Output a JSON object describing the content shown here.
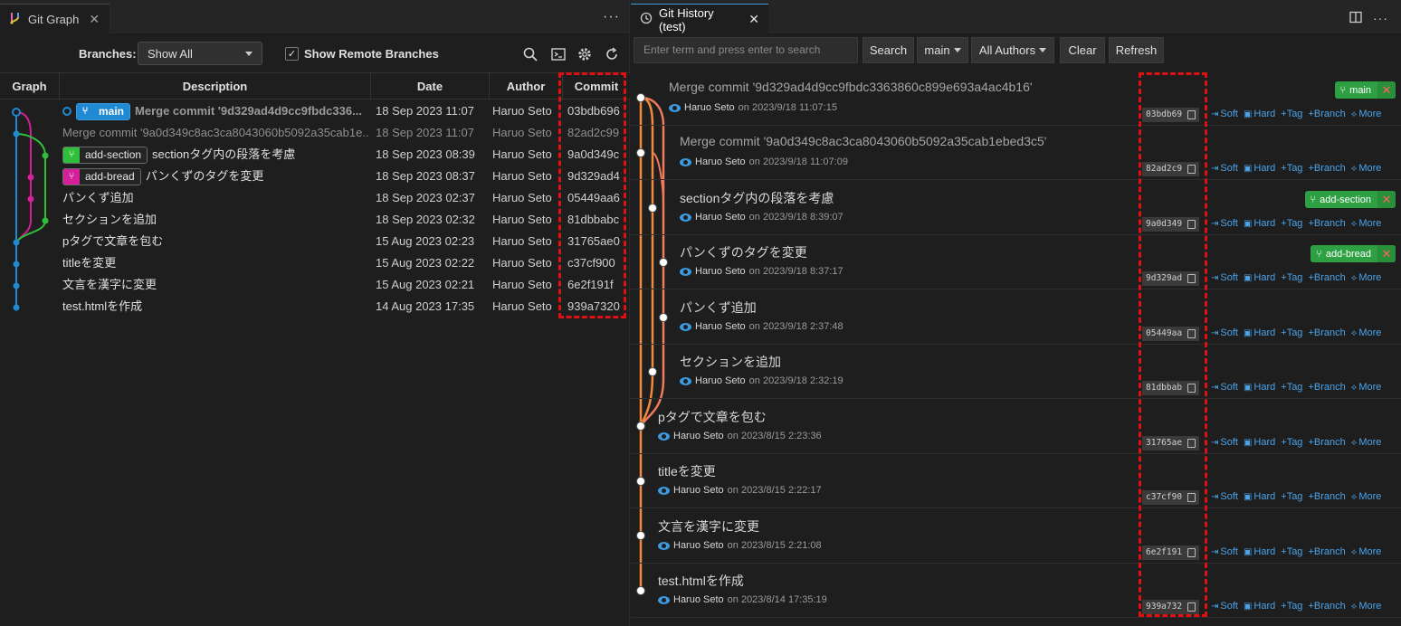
{
  "left_panel": {
    "tab_title": "Git Graph",
    "controls": {
      "branches_label": "Branches:",
      "branches_value": "Show All",
      "show_remote_label": "Show Remote Branches",
      "show_remote_checked": true
    },
    "columns": [
      "Graph",
      "Description",
      "Date",
      "Author",
      "Commit"
    ],
    "rows": [
      {
        "ref": "main",
        "desc": "Merge commit '9d329ad4d9cc9fbdc336...",
        "date": "18 Sep 2023 11:07",
        "author": "Haruo Seto",
        "commit": "03bdb696"
      },
      {
        "ref": "",
        "desc": "Merge commit '9a0d349c8ac3ca8043060b5092a35cab1e...",
        "date": "18 Sep 2023 11:07",
        "author": "Haruo Seto",
        "commit": "82ad2c99"
      },
      {
        "ref": "add-section",
        "desc": "sectionタグ内の段落を考慮",
        "date": "18 Sep 2023 08:39",
        "author": "Haruo Seto",
        "commit": "9a0d349c"
      },
      {
        "ref": "add-bread",
        "desc": "パンくずのタグを変更",
        "date": "18 Sep 2023 08:37",
        "author": "Haruo Seto",
        "commit": "9d329ad4"
      },
      {
        "ref": "",
        "desc": "パンくず追加",
        "date": "18 Sep 2023 02:37",
        "author": "Haruo Seto",
        "commit": "05449aa6"
      },
      {
        "ref": "",
        "desc": "セクションを追加",
        "date": "18 Sep 2023 02:32",
        "author": "Haruo Seto",
        "commit": "81dbbabc"
      },
      {
        "ref": "",
        "desc": "pタグで文章を包む",
        "date": "15 Aug 2023 02:23",
        "author": "Haruo Seto",
        "commit": "31765ae0"
      },
      {
        "ref": "",
        "desc": "titleを変更",
        "date": "15 Aug 2023 02:22",
        "author": "Haruo Seto",
        "commit": "c37cf900"
      },
      {
        "ref": "",
        "desc": "文言を漢字に変更",
        "date": "15 Aug 2023 02:21",
        "author": "Haruo Seto",
        "commit": "6e2f191f"
      },
      {
        "ref": "",
        "desc": "test.htmlを作成",
        "date": "14 Aug 2023 17:35",
        "author": "Haruo Seto",
        "commit": "939a7320"
      }
    ]
  },
  "right_panel": {
    "tab_title": "Git History (test)",
    "search_placeholder": "Enter term and press enter to search",
    "buttons": {
      "search": "Search",
      "branch": "main",
      "authors": "All Authors",
      "clear": "Clear",
      "refresh": "Refresh"
    },
    "actions": {
      "soft": "Soft",
      "hard": "Hard",
      "tag": "+Tag",
      "branch": "+Branch",
      "more": "More"
    },
    "commits": [
      {
        "msg": "Merge commit '9d329ad4d9cc9fbdc3363860c899e693a4ac4b16'",
        "author": "Haruo Seto",
        "when": "on 2023/9/18 11:07:15",
        "hash": "03bdb69",
        "branch": "main"
      },
      {
        "msg": "Merge commit '9a0d349c8ac3ca8043060b5092a35cab1ebed3c5'",
        "author": "Haruo Seto",
        "when": "on 2023/9/18 11:07:09",
        "hash": "82ad2c9",
        "branch": ""
      },
      {
        "msg": "sectionタグ内の段落を考慮",
        "author": "Haruo Seto",
        "when": "on 2023/9/18 8:39:07",
        "hash": "9a0d349",
        "branch": "add-section"
      },
      {
        "msg": "パンくずのタグを変更",
        "author": "Haruo Seto",
        "when": "on 2023/9/18 8:37:17",
        "hash": "9d329ad",
        "branch": "add-bread"
      },
      {
        "msg": "パンくず追加",
        "author": "Haruo Seto",
        "when": "on 2023/9/18 2:37:48",
        "hash": "05449aa",
        "branch": ""
      },
      {
        "msg": "セクションを追加",
        "author": "Haruo Seto",
        "when": "on 2023/9/18 2:32:19",
        "hash": "81dbbab",
        "branch": ""
      },
      {
        "msg": "pタグで文章を包む",
        "author": "Haruo Seto",
        "when": "on 2023/8/15 2:23:36",
        "hash": "31765ae",
        "branch": ""
      },
      {
        "msg": "titleを変更",
        "author": "Haruo Seto",
        "when": "on 2023/8/15 2:22:17",
        "hash": "c37cf90",
        "branch": ""
      },
      {
        "msg": "文言を漢字に変更",
        "author": "Haruo Seto",
        "when": "on 2023/8/15 2:21:08",
        "hash": "6e2f191",
        "branch": ""
      },
      {
        "msg": "test.htmlを作成",
        "author": "Haruo Seto",
        "when": "on 2023/8/14 17:35:19",
        "hash": "939a732",
        "branch": ""
      }
    ]
  },
  "colors": {
    "graph_blue": "#1f8ad2",
    "graph_magenta": "#d4209a",
    "graph_green": "#2fbf3a",
    "history_line": "#f08a3c",
    "history_line_alt": "#f07a5a",
    "branch_badge": "#2ea043",
    "highlight_dash": "#e01010"
  }
}
